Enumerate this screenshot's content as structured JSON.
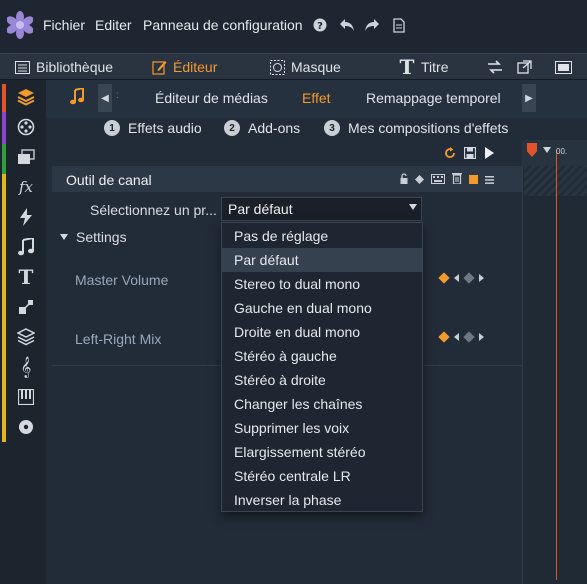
{
  "menu": {
    "items": [
      "Fichier",
      "Editer",
      "Panneau de configuration"
    ]
  },
  "toolbar_icons": [
    "help-icon",
    "undo-icon",
    "redo-icon",
    "document-icon"
  ],
  "top_tabs": {
    "library": "Bibliothèque",
    "editor": "Éditeur",
    "mask": "Masque",
    "title": "Titre"
  },
  "sidebar": {
    "icons": [
      "layers-icon",
      "film-reel-icon",
      "clips-icon",
      "fx-icon",
      "lightning-icon",
      "music-note-icon",
      "text-icon",
      "pan-zoom-icon",
      "stack-icon",
      "treble-clef-icon",
      "piano-icon",
      "disc-icon"
    ],
    "strip_colors": [
      "#e0532b",
      "#8d44c9",
      "#2f9e3f",
      "#e5b51f"
    ]
  },
  "subtabs": {
    "media_editor": "Éditeur de médias",
    "effect": "Effet",
    "time_remap": "Remappage temporel"
  },
  "addons": [
    {
      "num": "1",
      "label": "Effets audio"
    },
    {
      "num": "2",
      "label": "Add-ons"
    },
    {
      "num": "3",
      "label": "Mes compositions d'effets"
    }
  ],
  "timeline": {
    "time_label": "00."
  },
  "channel_tool": {
    "title": "Outil de canal",
    "preset_label": "Sélectionnez un pr...",
    "preset_value": "Par défaut",
    "settings_label": "Settings",
    "params": [
      {
        "label": "Master Volume"
      },
      {
        "label": "Left-Right Mix"
      }
    ]
  },
  "dropdown": {
    "options": [
      "Pas de réglage",
      "Par défaut",
      "Stereo to dual mono",
      "Gauche en dual mono",
      "Droite en dual mono",
      "Stéréo à gauche",
      "Stéréo à droite",
      "Changer les chaînes",
      "Supprimer les voix",
      "Elargissement stéréo",
      "Stéréo centrale LR",
      "Inverser la phase"
    ],
    "selected": "Par défaut"
  },
  "colors": {
    "accent": "#f39a2c",
    "playhead": "#e0532b",
    "background": "#202a36"
  }
}
